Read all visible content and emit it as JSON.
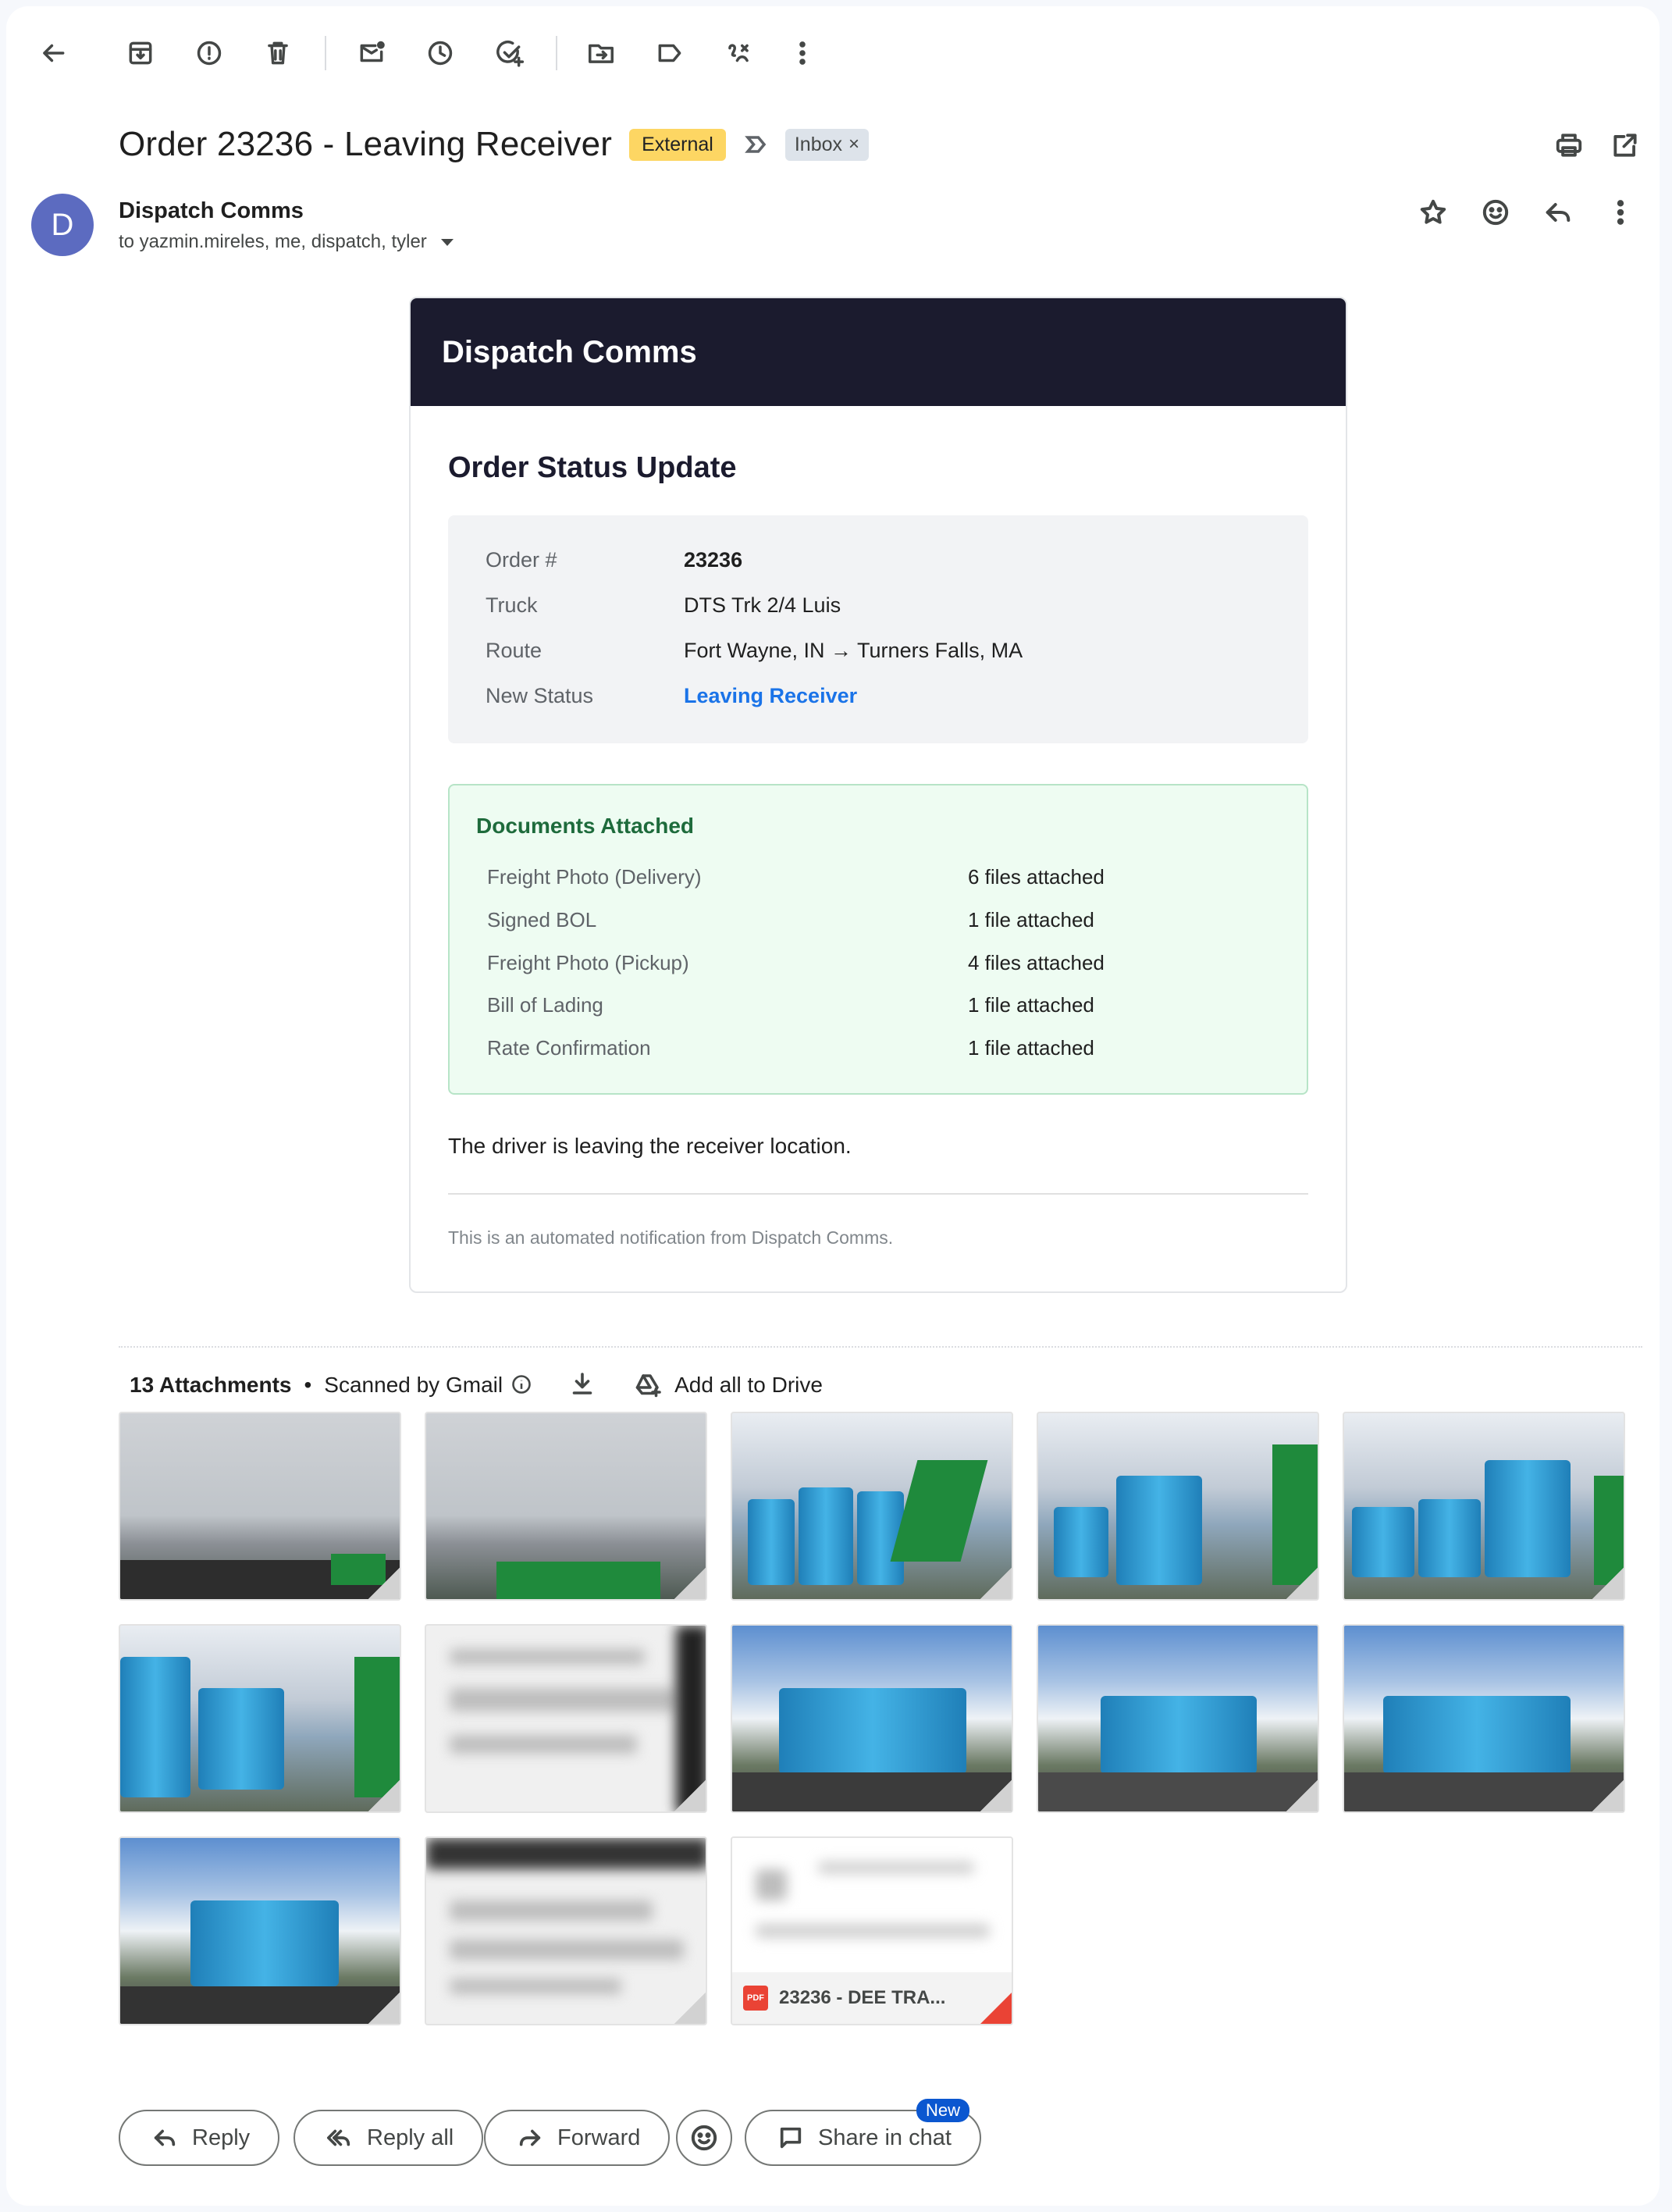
{
  "toolbar": {
    "icons": [
      "back-icon",
      "archive-icon",
      "report-spam-icon",
      "delete-icon",
      "mark-unread-icon",
      "snooze-icon",
      "add-task-icon",
      "move-to-icon",
      "label-icon",
      "filter-icon",
      "more-icon"
    ]
  },
  "email": {
    "subject": "Order 23236 - Leaving Receiver",
    "external_label": "External",
    "inbox_label": "Inbox",
    "inbox_remove": "×",
    "sender_initial": "D",
    "sender_name": "Dispatch Comms",
    "recipients": "to yazmin.mireles, me, dispatch, tyler"
  },
  "card": {
    "header": "Dispatch Comms",
    "title": "Order Status Update",
    "info": [
      {
        "label": "Order #",
        "value": "23236"
      },
      {
        "label": "Truck",
        "value": "DTS Trk 2/4 Luis"
      },
      {
        "label": "Route",
        "value": "Fort Wayne, IN → Turners Falls, MA"
      },
      {
        "label": "New Status",
        "value": "Leaving Receiver"
      }
    ],
    "docs_title": "Documents Attached",
    "docs": [
      {
        "label": "Freight Photo (Delivery)",
        "value": "6 files attached"
      },
      {
        "label": "Signed BOL",
        "value": "1 file attached"
      },
      {
        "label": "Freight Photo (Pickup)",
        "value": "4 files attached"
      },
      {
        "label": "Bill of Lading",
        "value": "1 file attached"
      },
      {
        "label": "Rate Confirmation",
        "value": "1 file attached"
      }
    ],
    "message": "The driver is leaving the receiver location.",
    "footer": "This is an automated notification from Dispatch Comms."
  },
  "attachments": {
    "count_label": "13 Attachments",
    "separator": "•",
    "scanned_label": "Scanned by Gmail",
    "add_drive_label": "Add all to Drive",
    "pdf_name": "23236 - DEE TRA...",
    "pdf_badge": "PDF"
  },
  "actions": {
    "reply": "Reply",
    "reply_all": "Reply all",
    "forward": "Forward",
    "share_chat": "Share in chat",
    "new_badge": "New"
  },
  "colors": {
    "header_bg": "#1b1b2e",
    "status_link": "#1a73e8",
    "external_chip": "#fdd663",
    "docs_bg": "#eefcf2",
    "avatar": "#5c6bc0"
  }
}
